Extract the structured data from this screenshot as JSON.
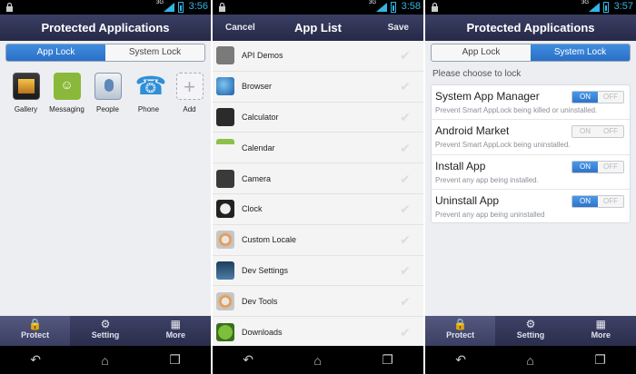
{
  "colors": {
    "accent": "#2e73c8",
    "titlebar": "#2a2d4c",
    "status_time": "#33b5e5"
  },
  "screens": {
    "s1": {
      "time": "3:56",
      "title": "Protected Applications",
      "segment": {
        "left": "App Lock",
        "right": "System Lock",
        "active": "left"
      },
      "apps": [
        {
          "label": "Gallery",
          "icon": "gallery-icon"
        },
        {
          "label": "Messaging",
          "icon": "messaging-icon"
        },
        {
          "label": "People",
          "icon": "people-icon"
        },
        {
          "label": "Phone",
          "icon": "phone-icon"
        },
        {
          "label": "Add",
          "icon": "add-icon"
        }
      ]
    },
    "s2": {
      "time": "3:58",
      "title": "App List",
      "cancel": "Cancel",
      "save": "Save",
      "items": [
        {
          "label": "API Demos",
          "icon": "api-demos-icon"
        },
        {
          "label": "Browser",
          "icon": "browser-icon"
        },
        {
          "label": "Calculator",
          "icon": "calculator-icon"
        },
        {
          "label": "Calendar",
          "icon": "calendar-icon"
        },
        {
          "label": "Camera",
          "icon": "camera-icon"
        },
        {
          "label": "Clock",
          "icon": "clock-icon"
        },
        {
          "label": "Custom Locale",
          "icon": "custom-locale-icon"
        },
        {
          "label": "Dev Settings",
          "icon": "dev-settings-icon"
        },
        {
          "label": "Dev Tools",
          "icon": "dev-tools-icon"
        },
        {
          "label": "Downloads",
          "icon": "downloads-icon"
        }
      ]
    },
    "s3": {
      "time": "3:57",
      "title": "Protected Applications",
      "segment": {
        "left": "App Lock",
        "right": "System Lock",
        "active": "right"
      },
      "prompt": "Please choose to lock",
      "options": [
        {
          "title": "System App Manager",
          "desc": "Prevent Smart AppLock being killed or uninstalled.",
          "on": true
        },
        {
          "title": "Android Market",
          "desc": "Prevent Smart AppLock being uninstalled.",
          "on": false
        },
        {
          "title": "Install App",
          "desc": "Prevent any app being installed.",
          "on": true
        },
        {
          "title": "Uninstall App",
          "desc": "Prevent any app being uninstalled",
          "on": true
        }
      ],
      "toggle_on": "ON",
      "toggle_off": "OFF"
    }
  },
  "nav": {
    "protect": "Protect",
    "setting": "Setting",
    "more": "More"
  },
  "status_net": "3G"
}
